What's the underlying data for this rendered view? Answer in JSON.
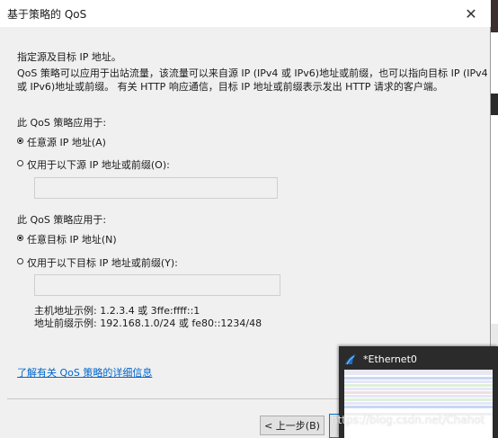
{
  "window": {
    "title": "基于策略的 QoS",
    "close_glyph": "✕"
  },
  "header": {
    "heading": "指定源及目标 IP 地址。",
    "description_line1": "QoS 策略可以应用于出站流量，该流量可以来自源 IP (IPv4 或 IPv6)地址或前缀，也可以指向目标 IP (IPv4",
    "description_line2": "或 IPv6)地址或前缀。 有关 HTTP 响应通信，目标 IP 地址或前缀表示发出 HTTP 请求的客户端。"
  },
  "source_section": {
    "label": "此 QoS 策略应用于:",
    "option_any": "任意源 IP 地址(A)",
    "option_only": "仅用于以下源 IP 地址或前缀(O):",
    "selected": "any",
    "input_value": ""
  },
  "dest_section": {
    "label": "此 QoS 策略应用于:",
    "option_any": "任意目标 IP 地址(N)",
    "option_only": "仅用于以下目标 IP 地址或前缀(Y):",
    "selected": "any",
    "input_value": ""
  },
  "examples": {
    "host": "主机地址示例: 1.2.3.4 或 3ffe:ffff::1",
    "prefix": "地址前缀示例: 192.168.1.0/24 或 fe80::1234/48"
  },
  "link": {
    "text": "了解有关 QoS 策略的详细信息"
  },
  "buttons": {
    "back": "< 上一步(B)"
  },
  "taskbar_thumbnail": {
    "title": "*Ethernet0",
    "icon": "wireshark-fin-icon"
  },
  "watermark": "https://blog.csdn.net/Chahot",
  "colors": {
    "link": "#0066cc",
    "dialog_bg": "#f0f0f0",
    "thumb_bg": "#2b2b2b",
    "focus_border": "#0078d7"
  }
}
